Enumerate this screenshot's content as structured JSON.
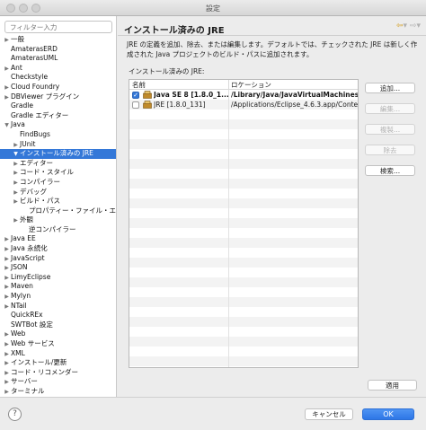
{
  "window": {
    "title": "設定"
  },
  "sidebar": {
    "filter_placeholder": "フィルター入力",
    "items": [
      {
        "label": "一般",
        "indent": 0,
        "arrow": "▶"
      },
      {
        "label": "AmaterasERD",
        "indent": 0,
        "arrow": ""
      },
      {
        "label": "AmaterasUML",
        "indent": 0,
        "arrow": ""
      },
      {
        "label": "Ant",
        "indent": 0,
        "arrow": "▶"
      },
      {
        "label": "Checkstyle",
        "indent": 0,
        "arrow": ""
      },
      {
        "label": "Cloud Foundry",
        "indent": 0,
        "arrow": "▶"
      },
      {
        "label": "DBViewer プラグイン",
        "indent": 0,
        "arrow": "▶"
      },
      {
        "label": "Gradle",
        "indent": 0,
        "arrow": ""
      },
      {
        "label": "Gradle エディター",
        "indent": 0,
        "arrow": ""
      },
      {
        "label": "Java",
        "indent": 0,
        "arrow": "▼"
      },
      {
        "label": "FindBugs",
        "indent": 1,
        "arrow": ""
      },
      {
        "label": "JUnit",
        "indent": 1,
        "arrow": "▶"
      },
      {
        "label": "インストール済みの JRE",
        "indent": 1,
        "arrow": "▼",
        "selected": true
      },
      {
        "label": "エディター",
        "indent": 1,
        "arrow": "▶"
      },
      {
        "label": "コード・スタイル",
        "indent": 1,
        "arrow": "▶"
      },
      {
        "label": "コンパイラー",
        "indent": 1,
        "arrow": "▶"
      },
      {
        "label": "デバッグ",
        "indent": 1,
        "arrow": "▶"
      },
      {
        "label": "ビルド・パス",
        "indent": 1,
        "arrow": "▶"
      },
      {
        "label": "プロパティー・ファイル・エ",
        "indent": 2,
        "arrow": ""
      },
      {
        "label": "外観",
        "indent": 1,
        "arrow": "▶"
      },
      {
        "label": "逆コンパイラー",
        "indent": 2,
        "arrow": ""
      },
      {
        "label": "Java EE",
        "indent": 0,
        "arrow": "▶"
      },
      {
        "label": "Java 永続化",
        "indent": 0,
        "arrow": "▶"
      },
      {
        "label": "JavaScript",
        "indent": 0,
        "arrow": "▶"
      },
      {
        "label": "JSON",
        "indent": 0,
        "arrow": "▶"
      },
      {
        "label": "LimyEclipse",
        "indent": 0,
        "arrow": "▶"
      },
      {
        "label": "Maven",
        "indent": 0,
        "arrow": "▶"
      },
      {
        "label": "Mylyn",
        "indent": 0,
        "arrow": "▶"
      },
      {
        "label": "NTail",
        "indent": 0,
        "arrow": "▶"
      },
      {
        "label": "QuickREx",
        "indent": 0,
        "arrow": ""
      },
      {
        "label": "SWTBot 設定",
        "indent": 0,
        "arrow": ""
      },
      {
        "label": "Web",
        "indent": 0,
        "arrow": "▶"
      },
      {
        "label": "Web サービス",
        "indent": 0,
        "arrow": "▶"
      },
      {
        "label": "XML",
        "indent": 0,
        "arrow": "▶"
      },
      {
        "label": "インストール/更新",
        "indent": 0,
        "arrow": "▶"
      },
      {
        "label": "コード・リコメンダー",
        "indent": 0,
        "arrow": "▶"
      },
      {
        "label": "サーバー",
        "indent": 0,
        "arrow": "▶"
      },
      {
        "label": "ターミナル",
        "indent": 0,
        "arrow": "▶"
      },
      {
        "label": "チーム",
        "indent": 0,
        "arrow": "▶"
      }
    ]
  },
  "page": {
    "title": "インストール済みの JRE",
    "back_icon": "⇦",
    "dropdown_icon": "▾",
    "forward_icon": "⇨",
    "description": "JRE の定義を追加、除去、または編集します。デフォルトでは、チェックされた JRE は新しく作成された Java プロジェクトのビルド・パスに追加されます。",
    "list_label": "インストール済みの JRE:",
    "columns": {
      "name": "名前",
      "location": "ロケーション"
    },
    "rows": [
      {
        "checked": true,
        "check_mark": "✓",
        "name": "Java SE 8 [1.8.0_1...",
        "location": "/Library/Java/JavaVirtualMachines/jdk",
        "bold": true
      },
      {
        "checked": false,
        "check_mark": "",
        "name": "JRE [1.8.0_131]",
        "location": "/Applications/Eclipse_4.6.3.app/Conten",
        "bold": false
      }
    ],
    "buttons": {
      "add": "追加...",
      "edit": "編集...",
      "copy": "複製...",
      "remove": "除去",
      "search": "検索..."
    },
    "apply": "適用"
  },
  "footer": {
    "help": "?",
    "cancel": "キャンセル",
    "ok": "OK"
  },
  "colors": {
    "accent": "#3478d8",
    "ok_button": "#2d76e6"
  }
}
